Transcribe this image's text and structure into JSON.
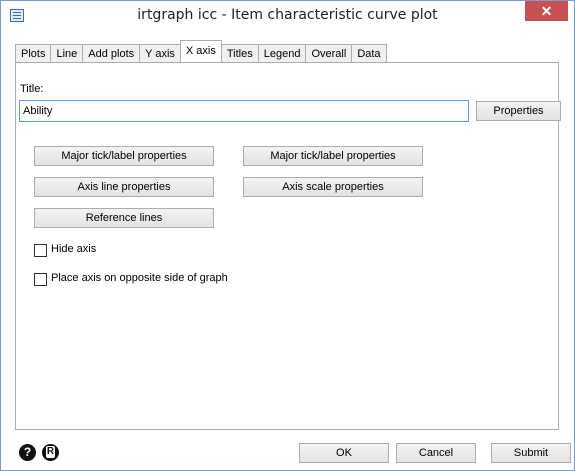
{
  "window": {
    "title": "irtgraph icc - Item characteristic curve plot",
    "close_glyph": "✕"
  },
  "tabs": [
    {
      "label": "Plots"
    },
    {
      "label": "Line"
    },
    {
      "label": "Add plots"
    },
    {
      "label": "Y axis"
    },
    {
      "label": "X axis",
      "active": true
    },
    {
      "label": "Titles"
    },
    {
      "label": "Legend"
    },
    {
      "label": "Overall"
    },
    {
      "label": "Data"
    }
  ],
  "xaxis": {
    "title_label": "Title:",
    "title_value": "Ability",
    "properties_button": "Properties",
    "buttons": {
      "major_tick_left": "Major tick/label properties",
      "major_tick_right": "Major tick/label properties",
      "axis_line": "Axis line properties",
      "axis_scale": "Axis scale properties",
      "reference_lines": "Reference lines"
    },
    "hide_axis": {
      "label": "Hide axis",
      "checked": false
    },
    "opposite_side": {
      "label": "Place axis on opposite side of graph",
      "checked": false
    }
  },
  "footer": {
    "help_glyph": "?",
    "ok": "OK",
    "cancel": "Cancel",
    "submit": "Submit"
  },
  "icons": [
    "app-icon",
    "close-icon",
    "help-icon",
    "reset-icon"
  ]
}
